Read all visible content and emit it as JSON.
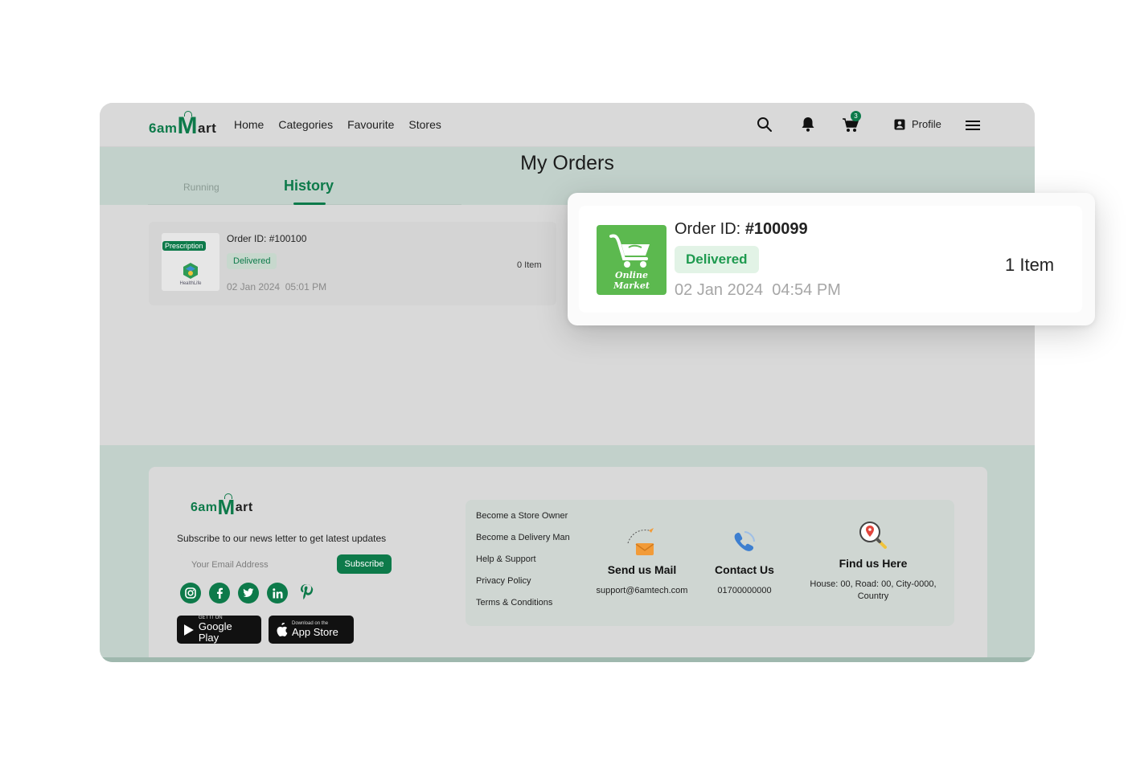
{
  "header": {
    "logo": {
      "part1": "6am",
      "part2": "M",
      "part3": "art"
    },
    "nav": [
      "Home",
      "Categories",
      "Favourite",
      "Stores"
    ],
    "cart_count": "3",
    "profile_label": "Profile"
  },
  "orders": {
    "title": "My Orders",
    "tabs": {
      "running": "Running",
      "history": "History"
    },
    "list": [
      {
        "tag": "Prescription",
        "store_label": "HealthLife",
        "order_id_label": "Order ID:",
        "order_id": "#100100",
        "status": "Delivered",
        "date": "02 Jan 2024",
        "time": "05:01 PM",
        "items": "0 Item"
      }
    ]
  },
  "highlight": {
    "store_label": "Online Market",
    "order_id_label": "Order ID:",
    "order_id": "#100099",
    "status": "Delivered",
    "date": "02 Jan 2024",
    "time": "04:54 PM",
    "items": "1 Item"
  },
  "footer": {
    "subscribe_text": "Subscribe to our news letter to get latest updates",
    "email_placeholder": "Your Email Address",
    "subscribe_button": "Subscribe",
    "socials": [
      "instagram-icon",
      "facebook-icon",
      "twitter-icon",
      "linkedin-icon",
      "pinterest-icon"
    ],
    "google_play": {
      "small": "GET IT ON",
      "big": "Google Play"
    },
    "app_store": {
      "small": "Download on the",
      "big": "App Store"
    },
    "links": [
      "Become a Store Owner",
      "Become a Delivery Man",
      "Help & Support",
      "Privacy Policy",
      "Terms & Conditions"
    ],
    "mail": {
      "title": "Send us Mail",
      "value": "support@6amtech.com"
    },
    "contact": {
      "title": "Contact Us",
      "value": "01700000000"
    },
    "find": {
      "title": "Find us Here",
      "value": "House: 00, Road: 00, City-0000, Country"
    }
  },
  "colors": {
    "brand": "#0d7a4a",
    "accent_green": "#5cb94f",
    "delivered_bg": "#e2f3e6"
  }
}
